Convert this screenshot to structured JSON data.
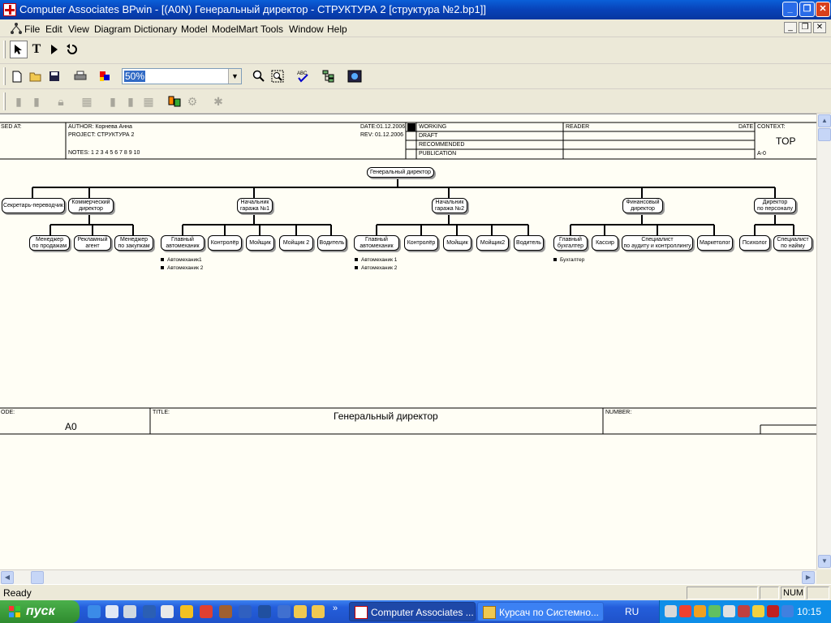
{
  "window": {
    "title": "Computer Associates BPwin - [(A0N) Генеральный директор - СТРУКТУРА 2  [структура №2.bp1]]"
  },
  "menu": [
    "File",
    "Edit",
    "View",
    "Diagram",
    "Dictionary",
    "Model",
    "ModelMart",
    "Tools",
    "Window",
    "Help"
  ],
  "toolbar": {
    "zoom_value": "50%"
  },
  "frame": {
    "used_at": "SED AT:",
    "author": "AUTHOR:  Корнева Анна",
    "project": "PROJECT:  СТРУКТУРА 2",
    "notes": "NOTES:  1  2  3  4  5  6  7  8  9  10",
    "date": "DATE:01.12.2006",
    "rev": "REV:  01.12.2006",
    "working": "WORKING",
    "draft": "DRAFT",
    "recommended": "RECOMMENDED",
    "publication": "PUBLICATION",
    "reader": "READER",
    "date2": "DATE",
    "context": "CONTEXT:",
    "top": "TOP",
    "a0_small": "A-0",
    "node_label": "ODE:",
    "node_value": "A0",
    "title_label": "TITLE:",
    "title_value": "Генеральный директор",
    "number_label": "NUMBER:"
  },
  "org": {
    "root": "Генеральный директор",
    "level1": [
      "Секретарь-переводчик",
      "Коммерческий\nдиректор",
      "Начальник\nгаража №1",
      "Начальник\nгаража №2",
      "Финансовый\nдиректор",
      "Директор\nпо персоналу"
    ],
    "commerce": [
      "Менеджер\nпо продажам",
      "Рекламный\nагент",
      "Менеджер\nпо закупкам"
    ],
    "garage1": [
      "Главный\nавтомеханик",
      "Контролёр",
      "Мойщик",
      "Мойщик 2",
      "Водитель"
    ],
    "garage1_bullets": [
      "Автомеханик1",
      "Автомеханик 2"
    ],
    "garage2": [
      "Главный\nавтомеханик",
      "Контролёр",
      "Мойщик",
      "Мойщик2",
      "Водитель"
    ],
    "garage2_bullets": [
      "Автомеханик 1",
      "Автомеханик 2"
    ],
    "finance": [
      "Главный\nбухгалтер",
      "Кассир",
      "Специалист\nпо аудиту и контроллингу",
      "Маркетолог"
    ],
    "finance_bullets": [
      "Бухгалтер"
    ],
    "personnel": [
      "Психолог",
      "Специалист\nпо найму"
    ]
  },
  "status": {
    "text": "Ready",
    "num": "NUM"
  },
  "taskbar": {
    "start": "пуск",
    "tasks": [
      "Computer Associates ...",
      "Курсач по Системно..."
    ],
    "lang": "RU",
    "clock": "10:15"
  },
  "colors": {
    "titlebar": "#0842b8",
    "canvas": "#fffef5",
    "taskbar": "#245edb",
    "start": "#2f8b2f"
  }
}
